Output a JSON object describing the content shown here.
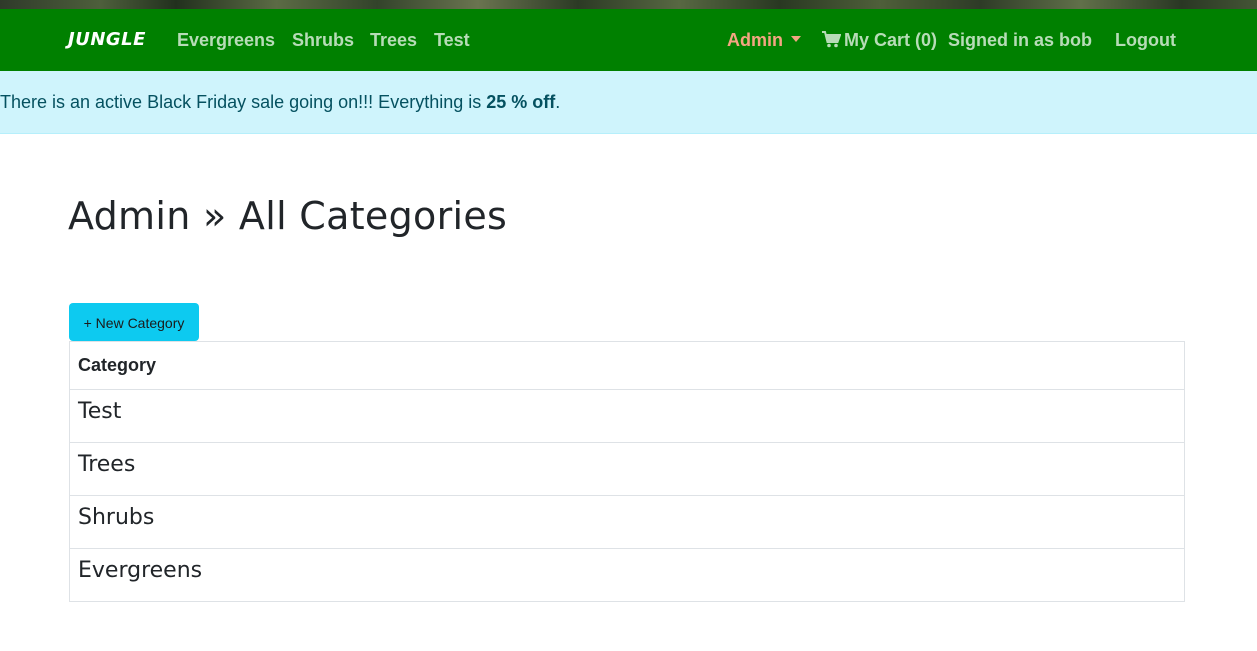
{
  "navbar": {
    "brand": "JUNGLE",
    "links": [
      "Evergreens",
      "Shrubs",
      "Trees",
      "Test"
    ],
    "admin": "Admin",
    "cart": "My Cart (0)",
    "signed_in": "Signed in as bob",
    "logout": "Logout",
    "colors": {
      "background": "#008000",
      "admin": "#f4a582"
    }
  },
  "alert": {
    "text_before": "There is an active Black Friday sale going on!!! Everything is ",
    "discount": "25 % off",
    "text_after": "."
  },
  "page": {
    "title": "Admin » All Categories",
    "new_button": "+ New Category"
  },
  "table": {
    "header": "Category",
    "rows": [
      "Test",
      "Trees",
      "Shrubs",
      "Evergreens"
    ]
  }
}
